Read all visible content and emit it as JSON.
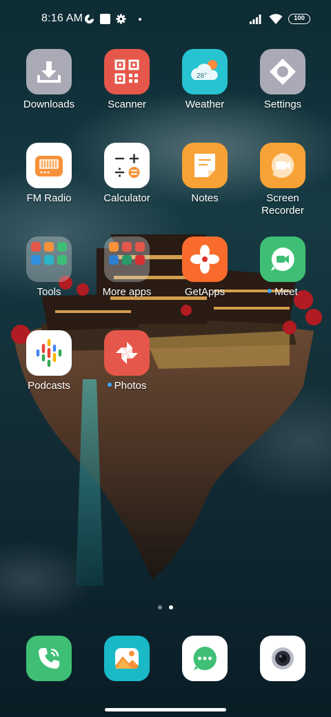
{
  "status_bar": {
    "time": "8:16 AM",
    "battery": "100",
    "icons": [
      "media-icon",
      "notification-square-icon",
      "gear-icon",
      "signal-icon",
      "wifi-icon",
      "battery-icon"
    ]
  },
  "apps": {
    "downloads": {
      "label": "Downloads",
      "icon": "download-icon",
      "color": "#a9aab6"
    },
    "scanner": {
      "label": "Scanner",
      "icon": "qr-code-icon",
      "color": "#e5574a"
    },
    "weather": {
      "label": "Weather",
      "icon": "weather-icon",
      "color": "#27c3d1",
      "temp": "28°"
    },
    "settings": {
      "label": "Settings",
      "icon": "gear-icon",
      "color": "#a9aab6"
    },
    "fm_radio": {
      "label": "FM Radio",
      "icon": "radio-icon",
      "color": "#ffffff"
    },
    "calculator": {
      "label": "Calculator",
      "icon": "calculator-icon",
      "color": "#ffffff"
    },
    "notes": {
      "label": "Notes",
      "icon": "notes-icon",
      "color": "#f7a236"
    },
    "screen_recorder": {
      "label": "Screen\nRecorder",
      "icon": "video-camera-icon",
      "color": "#f7a236"
    },
    "tools": {
      "label": "Tools",
      "icon": "folder-icon"
    },
    "more_apps": {
      "label": "More apps",
      "icon": "folder-icon"
    },
    "getapps": {
      "label": "GetApps",
      "icon": "pinwheel-icon",
      "color": "#f86b2c"
    },
    "meet": {
      "label": "Meet",
      "icon": "meet-icon",
      "color": "#3fbf75"
    },
    "podcasts": {
      "label": "Podcasts",
      "icon": "podcasts-icon",
      "color": "#ffffff"
    },
    "photos": {
      "label": "Photos",
      "icon": "pinwheel-icon",
      "color": "#e5574a"
    }
  },
  "dock": [
    {
      "name": "phone",
      "icon": "phone-icon",
      "color": "#3fbf75"
    },
    {
      "name": "gallery",
      "icon": "gallery-icon",
      "color": "#19b9c8"
    },
    {
      "name": "messaging",
      "icon": "message-icon",
      "color": "#ffffff"
    },
    {
      "name": "camera",
      "icon": "camera-icon",
      "color": "#ffffff"
    }
  ],
  "page_indicator": {
    "pages": 2,
    "active": 2
  }
}
